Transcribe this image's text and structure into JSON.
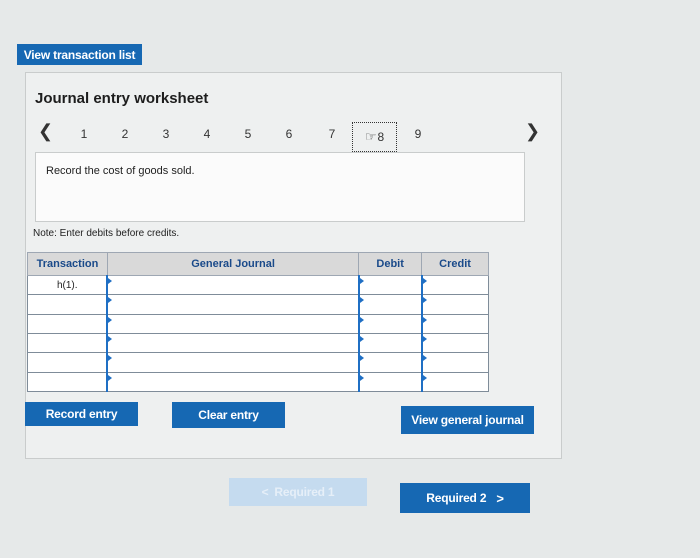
{
  "top": {
    "view_transaction_list": "View transaction list"
  },
  "worksheet": {
    "title": "Journal entry worksheet",
    "steps": [
      "1",
      "2",
      "3",
      "4",
      "5",
      "6",
      "7",
      "8",
      "9"
    ],
    "current_step": "8",
    "instruction": "Record the cost of goods sold.",
    "note": "Note: Enter debits before credits."
  },
  "table": {
    "headers": {
      "transaction": "Transaction",
      "general_journal": "General Journal",
      "debit": "Debit",
      "credit": "Credit"
    },
    "transaction_label": "h(1).",
    "row_count": 6
  },
  "buttons": {
    "record_entry": "Record entry",
    "clear_entry": "Clear entry",
    "view_general_journal": "View general journal"
  },
  "footer_nav": {
    "prev": "Required 1",
    "next": "Required 2"
  },
  "colors": {
    "primary": "#1668b3",
    "panel": "#eef0f0",
    "header": "#d9d9d9"
  }
}
